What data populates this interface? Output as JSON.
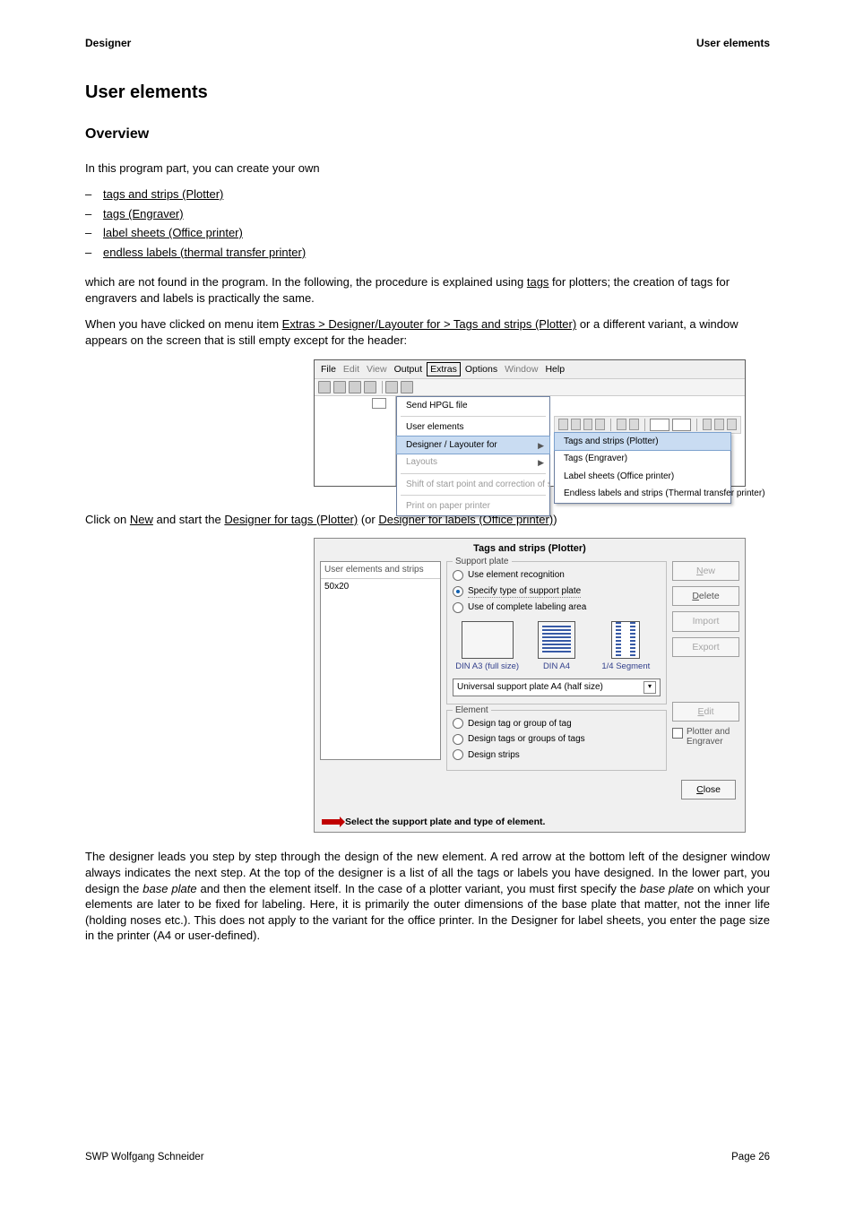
{
  "header": {
    "left": "Designer",
    "right": "User elements"
  },
  "footer": {
    "left": "SWP Wolfgang Schneider",
    "right": "Page 26"
  },
  "h1": "User elements",
  "h2": "Overview",
  "intro": "In this program part, you can create your own",
  "bullets": {
    "b1": "tags and strips (Plotter)",
    "b2": "tags (Engraver)",
    "b3": "label sheets (Office printer)",
    "b4": "endless labels (thermal transfer printer)"
  },
  "para2a": "which are not found in the program. In the following, the procedure is explained using ",
  "para2b": "tags",
  "para2c": " for plotters; the creation of tags for engravers and labels is practically the same.",
  "para3a": "When you have clicked on menu item ",
  "para3b": "Extras > Designer/Layouter for > Tags and strips (Plotter)",
  "para3c": " or a different variant, a window appears on the screen that is still empty except for the header:",
  "shot1": {
    "menubar": {
      "file": "File",
      "edit": "Edit",
      "view": "View",
      "output": "Output",
      "extras": "Extras",
      "options": "Options",
      "window": "Window",
      "help": "Help"
    },
    "dropdown": {
      "i1": "Send HPGL file",
      "i2": "User elements",
      "i3": "Designer / Layouter for",
      "i4": "Layouts",
      "i5": "Shift of start point and correction of scale factor",
      "i6": "Print on paper printer"
    },
    "submenu": {
      "s1": "Tags and strips (Plotter)",
      "s2": "Tags (Engraver)",
      "s3": "Label sheets (Office printer)",
      "s4": "Endless labels and strips (Thermal transfer printer)"
    }
  },
  "para4a": "Click on ",
  "para4b": "New",
  "para4c": " and start the ",
  "para4d": "Designer for tags (Plotter)",
  "para4e": " (or ",
  "para4f": "Designer for labels (Office printer)",
  "para4g": ")",
  "shot2": {
    "title": "Tags and strips (Plotter)",
    "list": {
      "header": "User elements and strips",
      "item": "50x20"
    },
    "support": {
      "legend": "Support plate",
      "o1": "Use element recognition",
      "o2": "Specify type of support plate",
      "o3": "Use of complete labeling area",
      "c1": "DIN A3 (full size)",
      "c2": "DIN A4",
      "c3": "1/4 Segment",
      "combo": "Universal support plate A4 (half size)"
    },
    "element": {
      "legend": "Element",
      "o1": "Design tag or group of tag",
      "o2": "Design tags or groups of tags",
      "o3": "Design strips"
    },
    "buttons": {
      "new": "New",
      "delete": "Delete",
      "import": "Import",
      "export": "Export",
      "edit": "Edit",
      "plotter": "Plotter and Engraver",
      "close": "Close"
    },
    "status": "Select the support plate and type of element."
  },
  "last": {
    "t1": "The designer leads you step by step through the design of the new element. A red arrow at the bottom left of the designer window always indicates the next step. At the top of the designer is a list of all the tags or labels you have designed. In the lower part, you design the ",
    "i1": "base plate",
    "t2": " and then the element itself. In the case of a plotter variant, you must first specify the ",
    "i2": "base plate",
    "t3": " on which your elements are later to be fixed for labeling. Here, it is primarily the outer dimensions of the base plate that matter, not the inner life (holding noses etc.). This does not apply to the variant for the office printer. In the Designer for label sheets, you enter the page size in the printer (A4 or user-defined)."
  }
}
